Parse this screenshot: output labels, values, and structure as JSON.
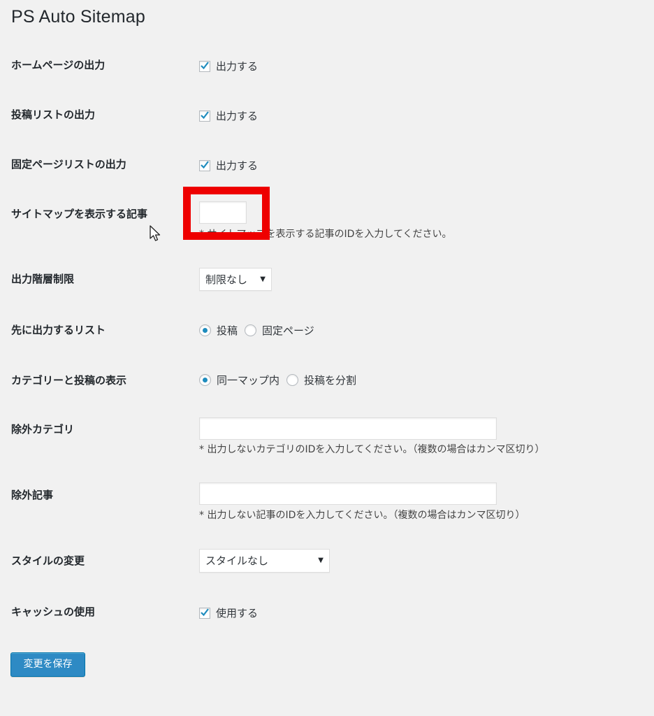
{
  "page": {
    "title": "PS Auto Sitemap"
  },
  "rows": {
    "home": {
      "label": "ホームページの出力",
      "option": "出力する",
      "checked": true
    },
    "posts": {
      "label": "投稿リストの出力",
      "option": "出力する",
      "checked": true
    },
    "pages": {
      "label": "固定ページリストの出力",
      "option": "出力する",
      "checked": true
    },
    "sitemap_post": {
      "label": "サイトマップを表示する記事",
      "value": "",
      "desc": "* サイトマップを表示する記事のIDを入力してください。"
    },
    "depth": {
      "label": "出力階層制限",
      "selected": "制限なし"
    },
    "first_list": {
      "label": "先に出力するリスト",
      "options": [
        "投稿",
        "固定ページ"
      ],
      "selected_index": 0
    },
    "category_display": {
      "label": "カテゴリーと投稿の表示",
      "options": [
        "同一マップ内",
        "投稿を分割"
      ],
      "selected_index": 0
    },
    "exclude_category": {
      "label": "除外カテゴリ",
      "value": "",
      "desc": "* 出力しないカテゴリのIDを入力してください。（複数の場合はカンマ区切り）"
    },
    "exclude_post": {
      "label": "除外記事",
      "value": "",
      "desc": "* 出力しない記事のIDを入力してください。（複数の場合はカンマ区切り）"
    },
    "style": {
      "label": "スタイルの変更",
      "selected": "スタイルなし"
    },
    "cache": {
      "label": "キャッシュの使用",
      "option": "使用する",
      "checked": true
    }
  },
  "save_label": "変更を保存",
  "colors": {
    "accent": "#1e8cbe",
    "button": "#2e8ac4",
    "highlight": "#ee0000",
    "background": "#f1f1f1"
  },
  "icons": {
    "check": "checkmark-icon",
    "select_arrow": "dropdown-arrow-icon",
    "cursor": "mouse-pointer-icon"
  }
}
